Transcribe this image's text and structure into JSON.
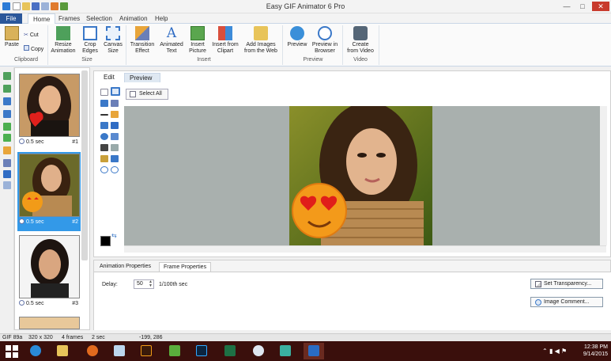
{
  "app": {
    "title": "Easy GIF Animator 6 Pro",
    "window_controls": {
      "minimize": "—",
      "maximize": "□",
      "close": "✕"
    }
  },
  "ribbon_tabs": [
    "File",
    "Home",
    "Frames",
    "Selection",
    "Animation",
    "Help"
  ],
  "ribbon": {
    "clipboard": {
      "paste": "Paste",
      "cut": "Cut",
      "copy": "Copy",
      "label": "Clipboard"
    },
    "size": {
      "resize": [
        "Resize",
        "Animation"
      ],
      "crop": [
        "Crop",
        "Edges"
      ],
      "canvas": [
        "Canvas",
        "Size"
      ],
      "label": "Size"
    },
    "insert": {
      "transition": [
        "Transition",
        "Effect"
      ],
      "animated_text": [
        "Animated",
        "Text"
      ],
      "insert_picture": [
        "Insert",
        "Picture"
      ],
      "insert_clipart": [
        "Insert from",
        "Clipart"
      ],
      "add_web": [
        "Add Images",
        "from the Web"
      ],
      "label": "Insert"
    },
    "preview": {
      "preview": [
        "Preview",
        ""
      ],
      "preview_browser": [
        "Preview in",
        "Browser"
      ],
      "label": "Preview"
    },
    "video": {
      "create": [
        "Create",
        "from Video"
      ],
      "label": "Video"
    }
  },
  "frames": [
    {
      "time": "0.5 sec",
      "num": "#1"
    },
    {
      "time": "0.5 sec",
      "num": "#2"
    },
    {
      "time": "0.5 sec",
      "num": "#3"
    }
  ],
  "editor": {
    "tabs": [
      "Edit",
      "Preview"
    ],
    "select_all": "Select All"
  },
  "properties": {
    "tabs": [
      "Animation Properties",
      "Frame Properties"
    ],
    "delay_label": "Delay:",
    "delay_value": "50",
    "delay_unit": "1/100th sec",
    "set_transparency": "Set Transparency...",
    "image_comment": "Image Comment..."
  },
  "statusbar": {
    "format": "GIF 89a",
    "dimensions": "320 x 320",
    "frames": "4 frames",
    "duration": "2 sec",
    "coords": "-199,  286"
  },
  "taskbar": {
    "time": "12:38 PM",
    "date": "9/14/2015"
  },
  "colors": {
    "file_tab": "#2b579a",
    "selected_frame": "#3399e8",
    "taskbar": "#3a0f0c",
    "canvas_bg": "#a9b0ae",
    "close_button": "#c83a2c"
  }
}
